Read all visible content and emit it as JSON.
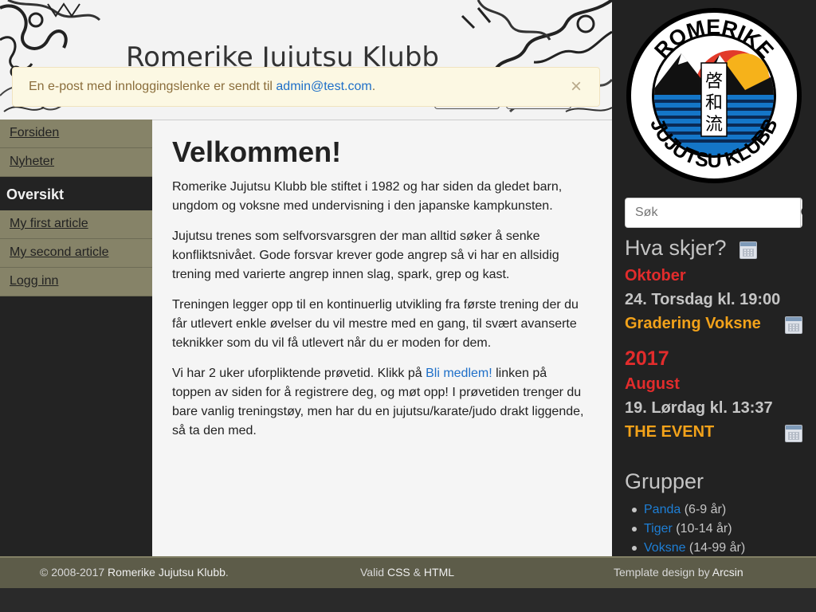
{
  "header": {
    "site_title": "Romerike Jujutsu Klubb"
  },
  "alert": {
    "text_before": "En e-post med innloggingslenke er sendt til ",
    "email": "admin@test.com",
    "text_after": ".",
    "close_label": "×"
  },
  "nav": {
    "items_top": [
      {
        "label": "Forsiden"
      },
      {
        "label": "Nyheter"
      }
    ],
    "section_title": "Oversikt",
    "items_bottom": [
      {
        "label": "My first article"
      },
      {
        "label": "My second article"
      },
      {
        "label": "Logg inn"
      }
    ]
  },
  "main": {
    "title": "Velkommen!",
    "p1": "Romerike Jujutsu Klubb ble stiftet i 1982 og har siden da gledet barn, ungdom og voksne med undervisning i den japanske kampkunsten.",
    "p2": "Jujutsu trenes som selfvorsvarsgren der man alltid søker å senke konfliktsnivået. Gode forsvar krever gode angrep så vi har en allsidig trening med varierte angrep innen slag, spark, grep og kast.",
    "p3": "Treningen legger opp til en kontinuerlig utvikling fra første trening der du får utlevert enkle øvelser du vil mestre med en gang, til svært avanserte teknikker som du vil få utlevert når du er moden for dem.",
    "p4_before": "Vi har 2 uker uforpliktende prøvetid. Klikk på ",
    "p4_link": "Bli medlem!",
    "p4_after": " linken på toppen av siden for å registrere deg, og møt opp! I prøvetiden trenger du bare vanlig treningstøy, men har du en jujutsu/karate/judo drakt liggende, så ta den med."
  },
  "logo": {
    "text_top": "ROMERIKE",
    "text_bottom": "JUJUTSU KLUBB",
    "kanji": [
      "啓",
      "和",
      "流"
    ]
  },
  "search": {
    "placeholder": "Søk",
    "icon": "search-icon"
  },
  "events": {
    "heading": "Hva skjer?",
    "month1": "Oktober",
    "ev1_when": "24. Torsdag kl. 19:00",
    "ev1_title": "Gradering Voksne",
    "year": "2017",
    "month2": "August",
    "ev2_when": "19. Lørdag kl. 13:37",
    "ev2_title": "THE EVENT",
    "icon": "calendar-icon"
  },
  "groups": {
    "heading": "Grupper",
    "items": [
      {
        "name": "Panda",
        "ages": " (6-9 år)"
      },
      {
        "name": "Tiger",
        "ages": " (10-14 år)"
      },
      {
        "name": "Voksne",
        "ages": " (14-99 år)"
      }
    ]
  },
  "footer": {
    "copyright": "© 2008-2017 ",
    "club": "Romerike Jujutsu Klubb",
    "club_suffix": ".",
    "valid_prefix": "Valid ",
    "css": "CSS",
    "amp": " & ",
    "html": "HTML",
    "design_prefix": "Template design by ",
    "designer": "Arcsin"
  },
  "colors": {
    "nav_bg": "#868368",
    "footer_bg": "#5d5c49",
    "accent_red": "#e22c2c",
    "event_orange": "#f2a21a",
    "link_blue": "#1e6fc8"
  }
}
